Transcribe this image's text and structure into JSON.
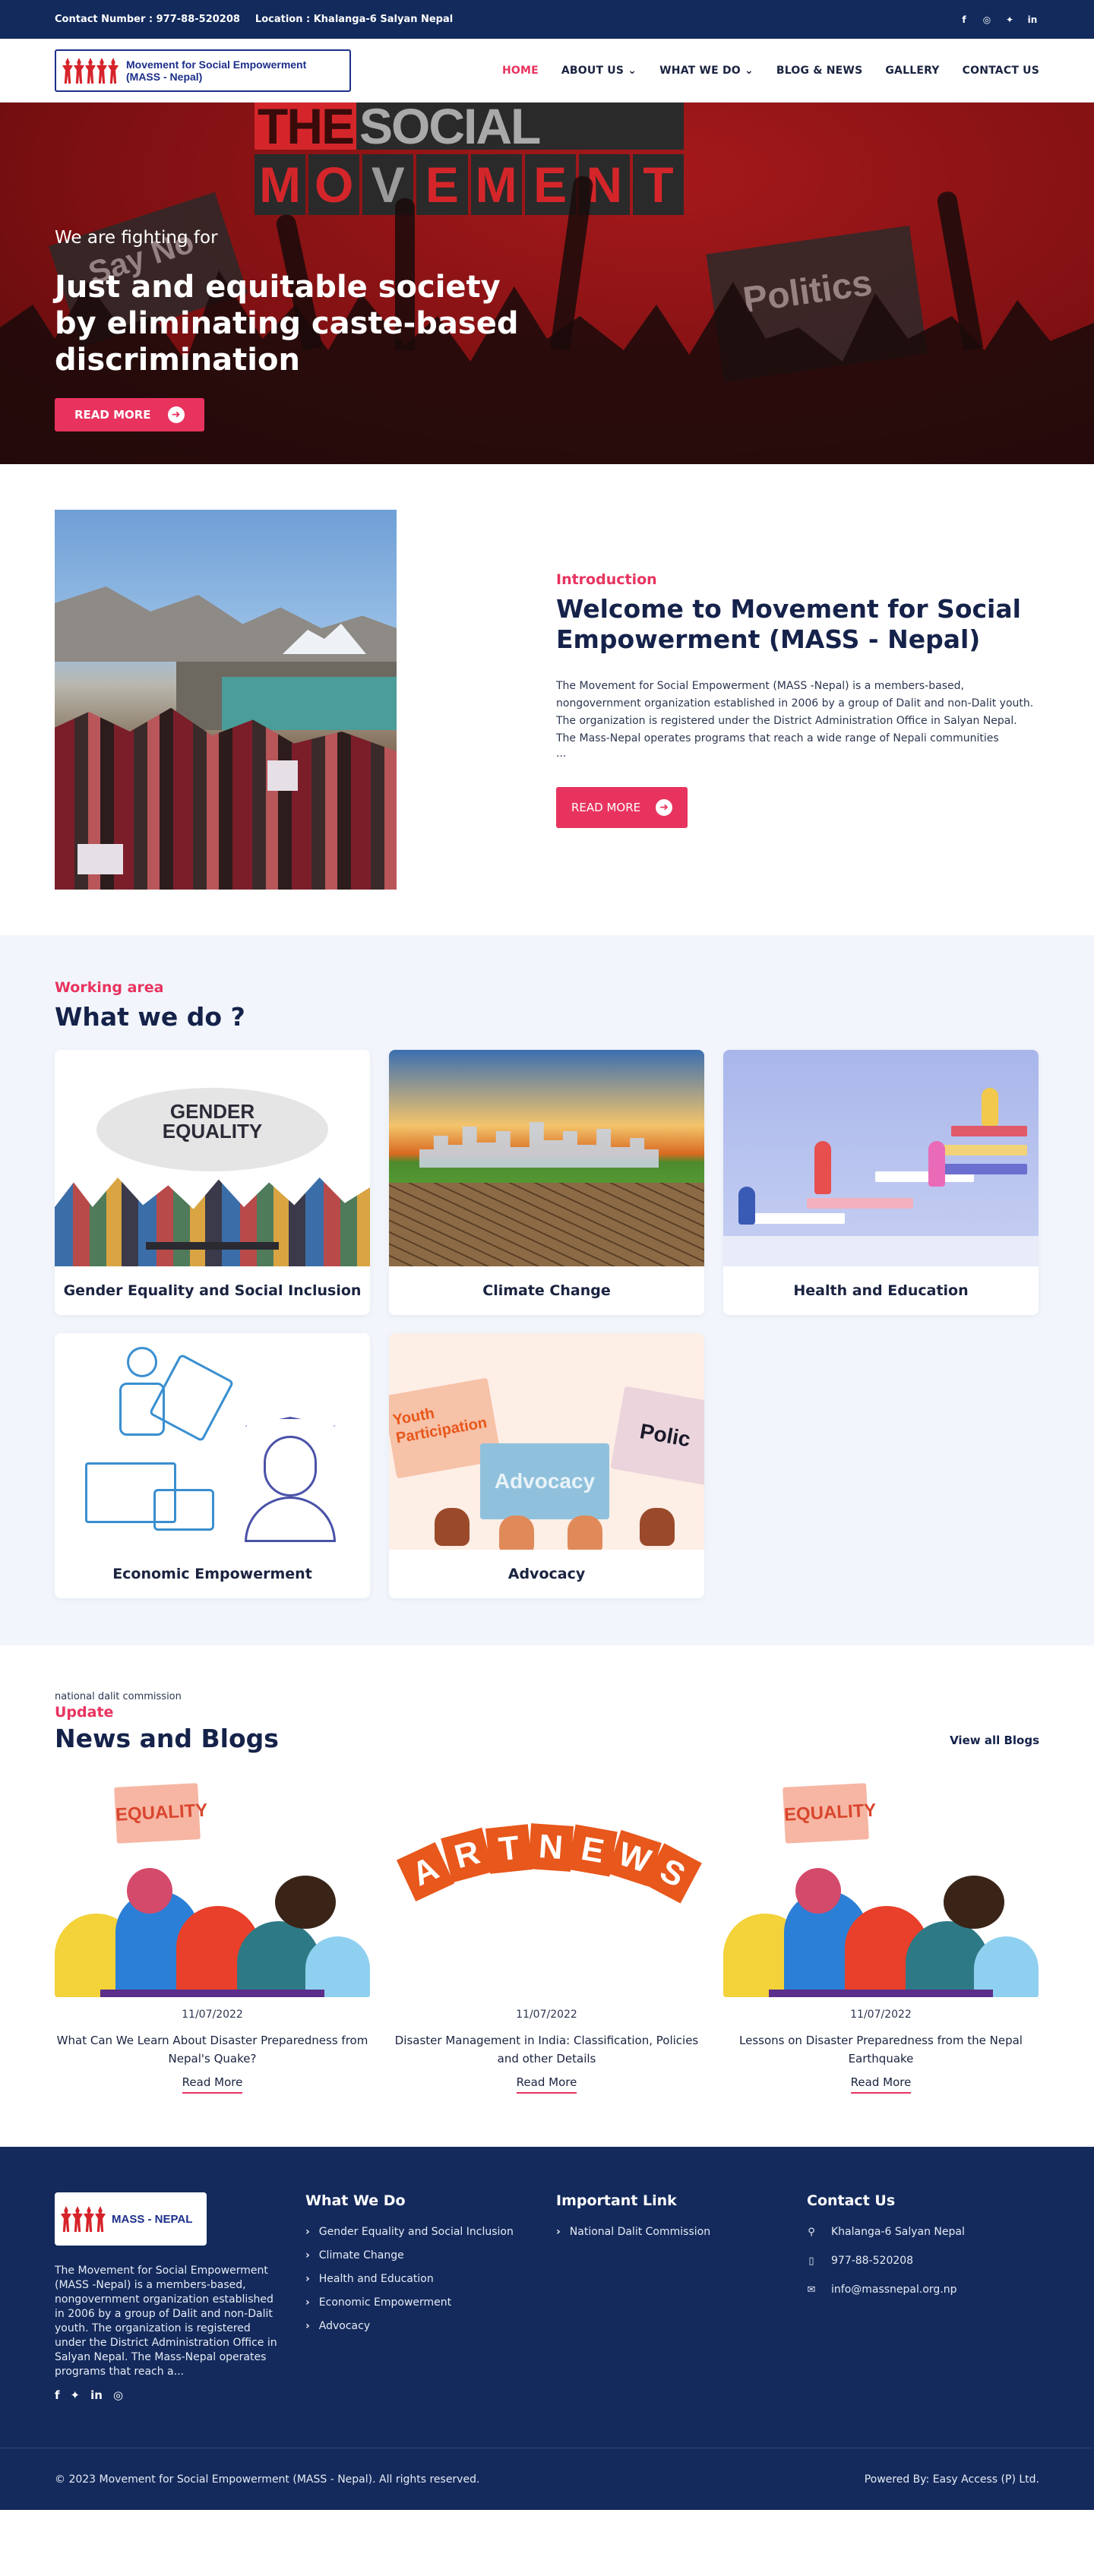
{
  "topbar": {
    "contact": "Contact Number : 977-88-520208",
    "location": "Location : Khalanga-6 Salyan Nepal",
    "social": [
      "facebook-icon",
      "instagram-icon",
      "twitter-icon",
      "linkedin-icon"
    ]
  },
  "header": {
    "logo_text": "Movement for Social Empowerment (MASS - Nepal)",
    "menu": [
      {
        "label": "HOME",
        "active": true
      },
      {
        "label": "ABOUT US",
        "dropdown": true
      },
      {
        "label": "WHAT WE DO",
        "dropdown": true
      },
      {
        "label": "BLOG & NEWS"
      },
      {
        "label": "GALLERY"
      },
      {
        "label": "CONTACT US"
      }
    ]
  },
  "hero": {
    "banner_words": {
      "the": "THE",
      "social": "SOCIAL",
      "movement": [
        "M",
        "O",
        "V",
        "E",
        "M",
        "E",
        "N",
        "T"
      ]
    },
    "sign_left": "Say No",
    "sign_right": "Politics",
    "kicker": "We are fighting for",
    "headline": "Just and equitable society by eliminating caste-based discrimination",
    "button": "READ MORE"
  },
  "intro": {
    "eyebrow": "Introduction",
    "title": "Welcome to Movement for Social Empowerment (MASS - Nepal)",
    "body": "The Movement for Social Empowerment (MASS -Nepal) is a members-based, nongovernment organization established in 2006 by a group of Dalit and non-Dalit youth. The organization is registered under the District Administration Office in Salyan Nepal. The Mass-Nepal operates programs that reach a wide range of Nepali communities",
    "ellipsis": "...",
    "button": "READ MORE"
  },
  "work": {
    "eyebrow": "Working area",
    "title": "What we do ?",
    "cards": [
      {
        "label": "Gender Equality and Social Inclusion",
        "image_text": "GENDER EQUALITY"
      },
      {
        "label": "Climate Change"
      },
      {
        "label": "Health and Education"
      },
      {
        "label": "Economic Empowerment"
      },
      {
        "label": "Advocacy",
        "image_text": [
          "Youth Participation",
          "Advocacy",
          "Polic"
        ]
      }
    ]
  },
  "news": {
    "small": "national dalit commission",
    "eyebrow": "Update",
    "title": "News and Blogs",
    "view_all": "View all Blogs",
    "posts": [
      {
        "date": "11/07/2022",
        "title": "What Can We Learn About Disaster Preparedness from Nepal's Quake?",
        "read": "Read More",
        "image_text": "EQUALITY"
      },
      {
        "date": "11/07/2022",
        "title": "Disaster Management in India: Classification, Policies and other Details",
        "read": "Read More",
        "image_text": [
          "A",
          "R",
          "T",
          "N",
          "E",
          "W",
          "S"
        ]
      },
      {
        "date": "11/07/2022",
        "title": "Lessons on Disaster Preparedness from the Nepal Earthquake",
        "read": "Read More",
        "image_text": "EQUALITY"
      }
    ]
  },
  "footer": {
    "logo_text": "MASS - NEPAL",
    "about": "The Movement for Social Empowerment (MASS -Nepal) is a members-based, nongovernment organization established in 2006 by a group of Dalit and non-Dalit youth. The organization is registered under the District Administration Office in Salyan Nepal. The Mass-Nepal operates programs that reach a...",
    "social": [
      "facebook-icon",
      "twitter-icon",
      "linkedin-icon",
      "instagram-icon"
    ],
    "what_we_do": {
      "title": "What We Do",
      "items": [
        "Gender Equality and Social Inclusion",
        "Climate Change",
        "Health and Education",
        "Economic Empowerment",
        "Advocacy"
      ]
    },
    "important": {
      "title": "Important Link",
      "items": [
        "National Dalit Commission"
      ]
    },
    "contact": {
      "title": "Contact Us",
      "address": "Khalanga-6 Salyan Nepal",
      "phone": "977-88-520208",
      "email": "info@massnepal.org.np"
    },
    "copyright": "© 2023 Movement for Social Empowerment (MASS - Nepal). All rights reserved.",
    "powered": "Powered By: Easy Access (P) Ltd."
  },
  "colors": {
    "navy": "#122a5c",
    "accent": "#e8335f",
    "hero_red": "#8e1416",
    "section_bg": "#f2f6fc"
  }
}
